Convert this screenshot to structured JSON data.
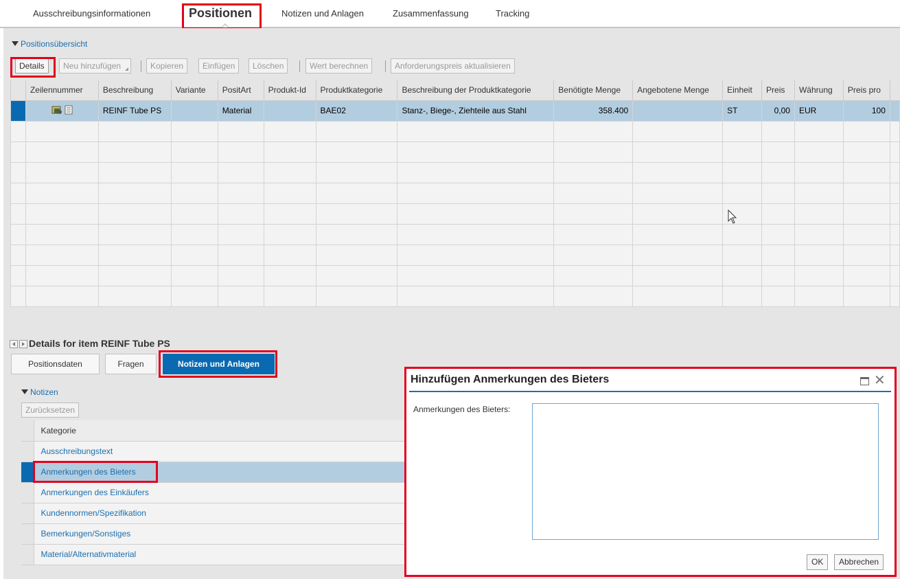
{
  "tabs": [
    {
      "label": "Ausschreibungsinformationen"
    },
    {
      "label": "Positionen"
    },
    {
      "label": "Notizen und Anlagen"
    },
    {
      "label": "Zusammenfassung"
    },
    {
      "label": "Tracking"
    }
  ],
  "overview": {
    "title": "Positionsübersicht",
    "toolbar": {
      "details": "Details",
      "add_new": "Neu hinzufügen",
      "copy": "Kopieren",
      "paste": "Einfügen",
      "delete": "Löschen",
      "calc_value": "Wert berechnen",
      "update_price": "Anforderungspreis aktualisieren"
    },
    "columns": [
      "Zeilennummer",
      "Beschreibung",
      "Variante",
      "PositArt",
      "Produkt-Id",
      "Produktkategorie",
      "Beschreibung der Produktkategorie",
      "Benötigte Menge",
      "Angebotene Menge",
      "Einheit",
      "Preis",
      "Währung",
      "Preis pro",
      ""
    ],
    "rows": [
      {
        "icons": [
          "item-detail-icon",
          "document-icon"
        ],
        "beschreibung": "REINF Tube PS",
        "variante": "",
        "positart": "Material",
        "produkt_id": "",
        "produktkategorie": "BAE02",
        "kategorie_beschreibung": "Stanz-, Biege-, Ziehteile aus Stahl",
        "benoetigte_menge": "358.400",
        "angebotene_menge": "",
        "einheit": "ST",
        "preis": "0,00",
        "waehrung": "EUR",
        "preis_pro": "100"
      }
    ]
  },
  "details": {
    "title": "Details for item  REINF Tube PS",
    "subtabs": [
      "Positionsdaten",
      "Fragen",
      "Notizen und Anlagen"
    ],
    "notes_title": "Notizen",
    "reset": "Zurücksetzen",
    "category_header": "Kategorie",
    "categories": [
      "Ausschreibungstext",
      "Anmerkungen des Bieters",
      "Anmerkungen des Einkäufers",
      "Kundennormen/Spezifikation",
      "Bemerkungen/Sonstiges",
      "Material/Alternativmaterial"
    ]
  },
  "dialog": {
    "title": "Hinzufügen Anmerkungen des Bieters",
    "field_label": "Anmerkungen des Bieters:",
    "field_value": "",
    "ok": "OK",
    "cancel": "Abbrechen"
  },
  "colors": {
    "highlight_red": "#e3001b",
    "accent_blue": "#0a6ab1",
    "selected_row": "#b3cde0"
  }
}
